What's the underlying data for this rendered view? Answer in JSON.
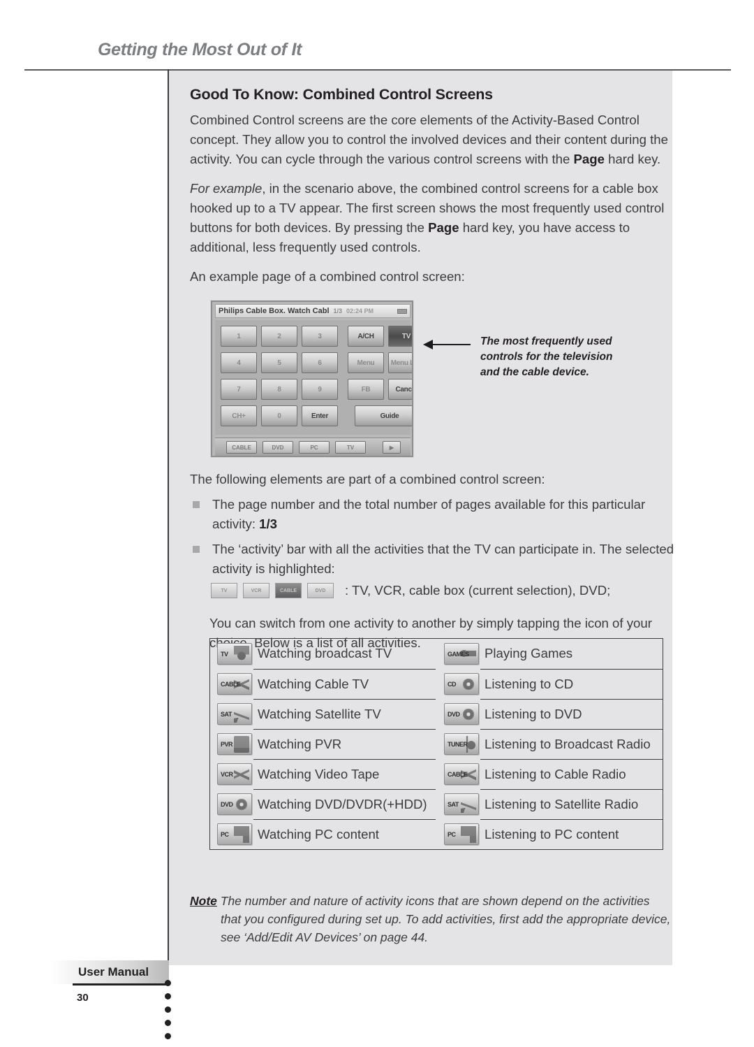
{
  "running_head": "Getting the Most Out of It",
  "section": {
    "title": "Good To Know: Combined Control Screens",
    "para1_a": "Combined Control screens are the core elements of the Activity-Based Control concept. They allow you to control the involved devices and their content during the activity. You can cycle through the various control screens with the ",
    "para1_bold": "Page",
    "para1_b": " hard key.",
    "para2_italic": "For example",
    "para2_a": ", in the scenario above, the combined control screens for a cable box hooked up to a TV appear. The first screen shows the most frequently used control buttons for both devices. By pressing the ",
    "para2_bold": "Page",
    "para2_b": " hard key, you have access to additional, less frequently used controls.",
    "para3": "An example page of a combined control screen:"
  },
  "screenshot": {
    "title": "Philips Cable Box. Watch Cabl",
    "page_indicator": "1/3",
    "time": "02:24 PM",
    "battery_icon": "battery-icon",
    "keys": [
      {
        "label": "1"
      },
      {
        "label": "2"
      },
      {
        "label": "3"
      },
      {
        "label": "A/CH"
      },
      {
        "label": "TV",
        "state": "selected"
      },
      {
        "label": "4"
      },
      {
        "label": "5"
      },
      {
        "label": "6"
      },
      {
        "label": "Menu"
      },
      {
        "label": "Menu Left"
      },
      {
        "label": "7"
      },
      {
        "label": "8"
      },
      {
        "label": "9"
      },
      {
        "label": "FB"
      },
      {
        "label": "Cancel"
      },
      {
        "label": "CH+"
      },
      {
        "label": "0"
      },
      {
        "label": "Enter"
      },
      {
        "label": "Guide"
      }
    ],
    "bottom_bar_icons": [
      "cable-activity-icon",
      "dvd-activity-icon",
      "pc-activity-icon",
      "tv-activity-icon",
      "page-next-icon"
    ]
  },
  "callout": {
    "line1": "The most frequently used",
    "line2": "controls for the television",
    "line3": "and the cable device."
  },
  "elements_intro": "The following elements are part of a combined control screen:",
  "bullets": [
    {
      "text_a": "The page number and the total number of pages available for this particular activity: ",
      "text_bold": "1/3"
    },
    {
      "text_a": "The ‘activity’ bar with all the activities that the TV can participate in. The selected activity is highlighted:"
    }
  ],
  "activity_bar": {
    "icons": [
      {
        "name": "tv-mini-icon",
        "tag": "TV",
        "selected": false
      },
      {
        "name": "vcr-mini-icon",
        "tag": "VCR",
        "selected": false
      },
      {
        "name": "cable-mini-icon",
        "tag": "CABLE",
        "selected": true
      },
      {
        "name": "dvd-mini-icon",
        "tag": "DVD",
        "selected": false
      }
    ],
    "legend": ": TV, VCR, cable box (current selection), DVD;"
  },
  "switch_text": "You can switch from one activity to another by simply tapping the icon of your choice. Below is a list of all activities.",
  "activity_table": {
    "left": [
      {
        "icon_name": "tv-activity-icon",
        "tag": "TV",
        "glyph": "gl-tv",
        "label": "Watching broadcast TV"
      },
      {
        "icon_name": "cable-activity-icon",
        "tag": "CABLE",
        "glyph": "gl-wave",
        "label": "Watching Cable TV"
      },
      {
        "icon_name": "satellite-activity-icon",
        "tag": "SAT",
        "glyph": "gl-dish",
        "label": "Watching Satellite TV"
      },
      {
        "icon_name": "pvr-activity-icon",
        "tag": "PVR",
        "glyph": "gl-box",
        "label": "Watching PVR"
      },
      {
        "icon_name": "vcr-activity-icon",
        "tag": "VCR",
        "glyph": "gl-wave",
        "label": "Watching Video Tape"
      },
      {
        "icon_name": "dvd-activity-icon",
        "tag": "DVD",
        "glyph": "gl-disc",
        "label": "Watching DVD/DVDR(+HDD)"
      },
      {
        "icon_name": "pc-activity-icon",
        "tag": "PC",
        "glyph": "gl-pc",
        "label": "Watching PC content"
      }
    ],
    "right": [
      {
        "icon_name": "games-activity-icon",
        "tag": "GAMES",
        "glyph": "gl-game",
        "label": "Playing Games"
      },
      {
        "icon_name": "cd-activity-icon",
        "tag": "CD",
        "glyph": "gl-disc",
        "label": "Listening to CD"
      },
      {
        "icon_name": "dvd-audio-activity-icon",
        "tag": "DVD",
        "glyph": "gl-disc",
        "label": "Listening to DVD"
      },
      {
        "icon_name": "tuner-activity-icon",
        "tag": "TUNER",
        "glyph": "gl-tuner",
        "label": "Listening to Broadcast Radio"
      },
      {
        "icon_name": "cable-radio-activity-icon",
        "tag": "CABLE",
        "glyph": "gl-wave",
        "label": "Listening to Cable Radio"
      },
      {
        "icon_name": "satellite-radio-activity-icon",
        "tag": "SAT",
        "glyph": "gl-dish",
        "label": "Listening to Satellite Radio"
      },
      {
        "icon_name": "pc-audio-activity-icon",
        "tag": "PC",
        "glyph": "gl-pc",
        "label": "Listening to PC content"
      }
    ]
  },
  "note": {
    "label": "Note",
    "line1": " The number and nature of activity icons that are shown depend on the activities",
    "line2": "that you configured during set up. To add activities, first add the appropriate device,",
    "line3": "see ‘Add/Edit AV Devices’ on page 44."
  },
  "footer": {
    "manual_label": "User Manual",
    "page_number": "30"
  },
  "colors": {
    "panel_bg": "#e4e4e6",
    "text": "#3b3b3d",
    "heading": "#231f20",
    "runhead": "#7b7d80",
    "rule": "#58595b"
  }
}
